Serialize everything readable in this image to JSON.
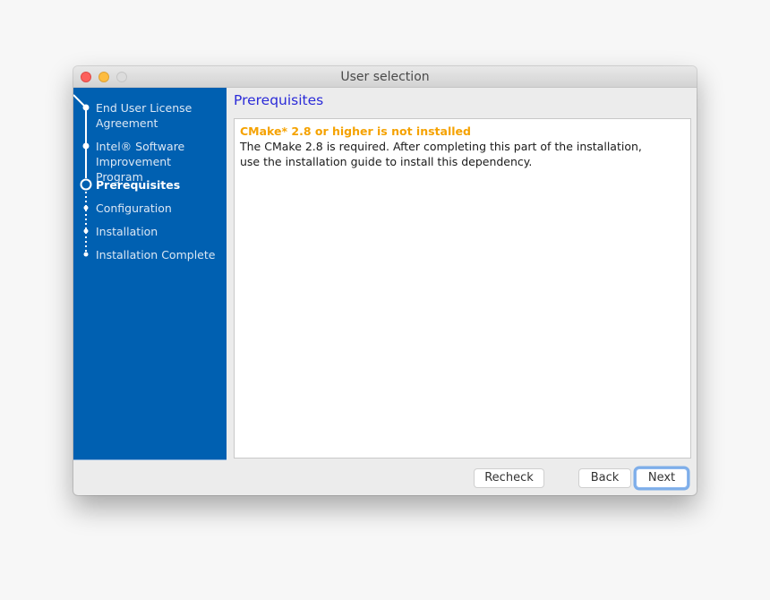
{
  "window": {
    "title": "User selection",
    "controls": [
      "close",
      "minimize",
      "zoom"
    ]
  },
  "sidebar": {
    "background": "#0060b1",
    "steps": [
      {
        "label": "End User License Agreement",
        "state": "done"
      },
      {
        "label": "Intel® Software Improvement Program",
        "state": "done"
      },
      {
        "label": "Prerequisites",
        "state": "current"
      },
      {
        "label": "Configuration",
        "state": "pending"
      },
      {
        "label": "Installation",
        "state": "pending"
      },
      {
        "label": "Installation Complete",
        "state": "pending"
      }
    ]
  },
  "main": {
    "heading": "Prerequisites",
    "message": {
      "title": "CMake* 2.8 or higher is not installed",
      "body": "The CMake 2.8 is required. After completing this part of the installation, use the installation guide to install this dependency.",
      "title_color": "#f5a200"
    }
  },
  "buttons": {
    "recheck": "Recheck",
    "back": "Back",
    "next": "Next"
  }
}
